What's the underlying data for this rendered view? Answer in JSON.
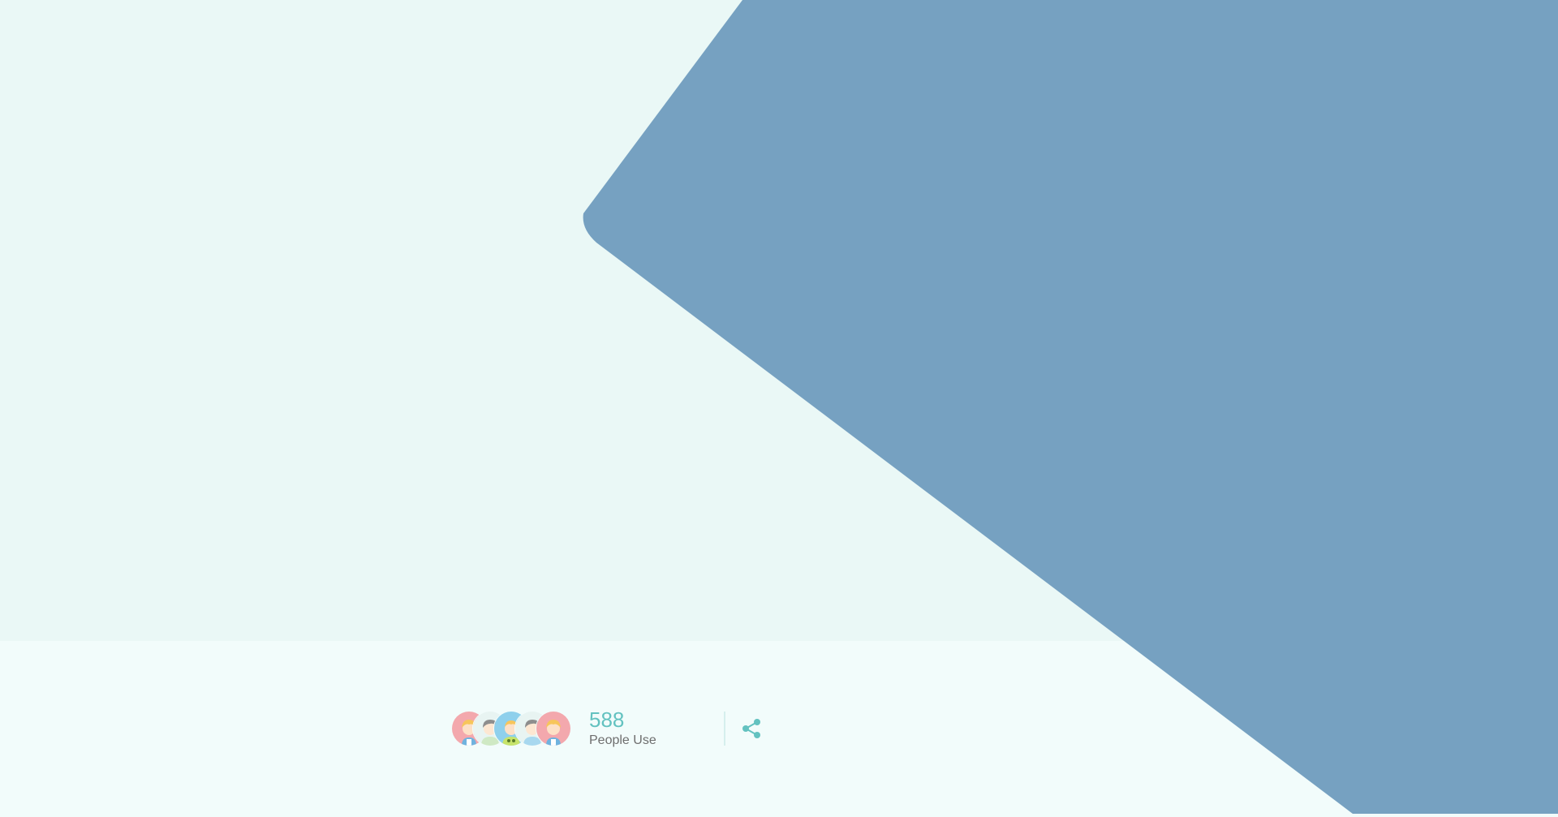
{
  "stats": {
    "count": "588",
    "label": "People Use"
  },
  "avatars": [
    {
      "icon": "girl-avatar-icon",
      "bg": "#f3a8ad"
    },
    {
      "icon": "grey-hair-person-avatar-icon",
      "bg": "#e8f4f2"
    },
    {
      "icon": "blue-ring-avatar-icon",
      "bg": "#8fd0ec"
    },
    {
      "icon": "grey-hair-person-avatar-icon",
      "bg": "#e8f4f2"
    },
    {
      "icon": "girl-avatar-icon",
      "bg": "#f3a8ad"
    }
  ],
  "share": {
    "icon": "share-icon"
  },
  "colors": {
    "hero": "#76a1c1",
    "top_background": "#eaf8f6",
    "bottom_background": "#f2fcfb",
    "accent": "#63c2c0",
    "label": "#6e6e6e"
  }
}
